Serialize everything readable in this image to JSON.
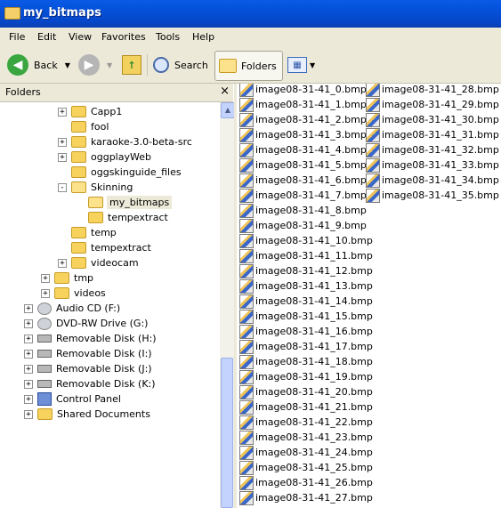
{
  "window": {
    "title": "my_bitmaps"
  },
  "menu": [
    "File",
    "Edit",
    "View",
    "Favorites",
    "Tools",
    "Help"
  ],
  "toolbar": {
    "back": "Back",
    "search": "Search",
    "folders": "Folders"
  },
  "left_pane": {
    "header": "Folders",
    "close": "×",
    "tree": [
      {
        "label": "Capp1",
        "level": 3,
        "expander": "+",
        "icon": "folder-icon"
      },
      {
        "label": "fool",
        "level": 3,
        "expander": "",
        "icon": "folder-icon"
      },
      {
        "label": "karaoke-3.0-beta-src",
        "level": 3,
        "expander": "+",
        "icon": "folder-icon"
      },
      {
        "label": "oggplayWeb",
        "level": 3,
        "expander": "+",
        "icon": "folder-icon"
      },
      {
        "label": "oggskinguide_files",
        "level": 3,
        "expander": "",
        "icon": "folder-icon"
      },
      {
        "label": "Skinning",
        "level": 3,
        "expander": "-",
        "icon": "open-folder-icon"
      },
      {
        "label": "my_bitmaps",
        "level": 4,
        "expander": "",
        "icon": "open-folder-icon",
        "selected": true
      },
      {
        "label": "tempextract",
        "level": 4,
        "expander": "",
        "icon": "folder-icon"
      },
      {
        "label": "temp",
        "level": 3,
        "expander": "",
        "icon": "folder-icon"
      },
      {
        "label": "tempextract",
        "level": 3,
        "expander": "",
        "icon": "folder-icon"
      },
      {
        "label": "videocam",
        "level": 3,
        "expander": "+",
        "icon": "folder-icon"
      },
      {
        "label": "tmp",
        "level": 2,
        "expander": "+",
        "icon": "folder-icon"
      },
      {
        "label": "videos",
        "level": 2,
        "expander": "+",
        "icon": "folder-icon"
      },
      {
        "label": "Audio CD (F:)",
        "level": 1,
        "expander": "+",
        "icon": "cd-icon"
      },
      {
        "label": "DVD-RW Drive (G:)",
        "level": 1,
        "expander": "+",
        "icon": "dvd-icon"
      },
      {
        "label": "Removable Disk (H:)",
        "level": 1,
        "expander": "+",
        "icon": "removable-disk-icon"
      },
      {
        "label": "Removable Disk (I:)",
        "level": 1,
        "expander": "+",
        "icon": "removable-disk-icon"
      },
      {
        "label": "Removable Disk (J:)",
        "level": 1,
        "expander": "+",
        "icon": "removable-disk-icon"
      },
      {
        "label": "Removable Disk (K:)",
        "level": 1,
        "expander": "+",
        "icon": "removable-disk-icon"
      },
      {
        "label": "Control Panel",
        "level": 1,
        "expander": "+",
        "icon": "control-panel-icon"
      },
      {
        "label": "Shared Documents",
        "level": 1,
        "expander": "+",
        "icon": "folder-icon"
      }
    ]
  },
  "files": [
    "image08-31-41_0.bmp",
    "image08-31-41_1.bmp",
    "image08-31-41_2.bmp",
    "image08-31-41_3.bmp",
    "image08-31-41_4.bmp",
    "image08-31-41_5.bmp",
    "image08-31-41_6.bmp",
    "image08-31-41_7.bmp",
    "image08-31-41_8.bmp",
    "image08-31-41_9.bmp",
    "image08-31-41_10.bmp",
    "image08-31-41_11.bmp",
    "image08-31-41_12.bmp",
    "image08-31-41_13.bmp",
    "image08-31-41_14.bmp",
    "image08-31-41_15.bmp",
    "image08-31-41_16.bmp",
    "image08-31-41_17.bmp",
    "image08-31-41_18.bmp",
    "image08-31-41_19.bmp",
    "image08-31-41_20.bmp",
    "image08-31-41_21.bmp",
    "image08-31-41_22.bmp",
    "image08-31-41_23.bmp",
    "image08-31-41_24.bmp",
    "image08-31-41_25.bmp",
    "image08-31-41_26.bmp",
    "image08-31-41_27.bmp",
    "image08-31-41_28.bmp",
    "image08-31-41_29.bmp",
    "image08-31-41_30.bmp",
    "image08-31-41_31.bmp",
    "image08-31-41_32.bmp",
    "image08-31-41_33.bmp",
    "image08-31-41_34.bmp",
    "image08-31-41_35.bmp"
  ],
  "colors": {
    "title_bar": "#0a5ae6",
    "chrome": "#ece9d8",
    "scrollbar": "#c3d3fd"
  }
}
